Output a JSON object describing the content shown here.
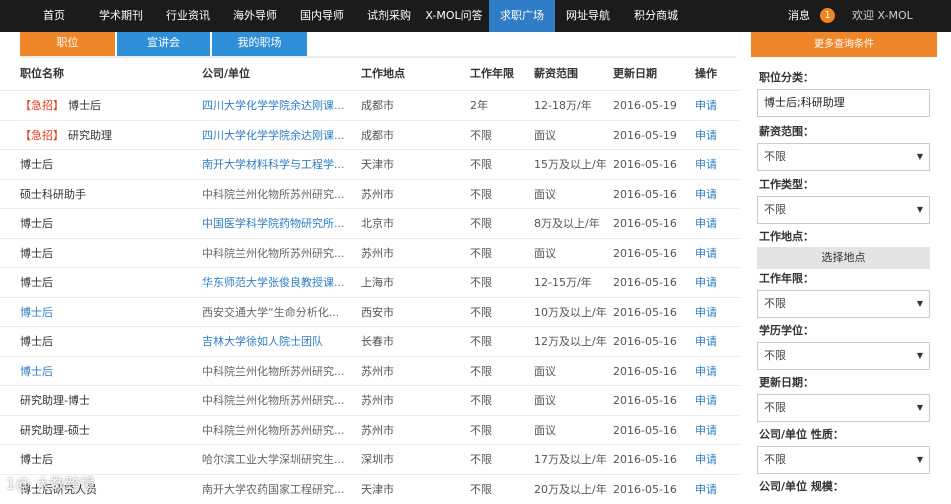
{
  "nav": {
    "items": [
      {
        "label": "首页",
        "active": false
      },
      {
        "label": "学术期刊",
        "active": false
      },
      {
        "label": "行业资讯",
        "active": false
      },
      {
        "label": "海外导师",
        "active": false
      },
      {
        "label": "国内导师",
        "active": false
      },
      {
        "label": "试剂采购",
        "active": false
      },
      {
        "label": "X-MOL问答",
        "active": false
      },
      {
        "label": "求职广场",
        "active": true
      },
      {
        "label": "网址导航",
        "active": false
      },
      {
        "label": "积分商城",
        "active": false
      }
    ],
    "messages_label": "消息",
    "messages_count": "1",
    "welcome": "欢迎 X-MOL"
  },
  "tabs": [
    "职位",
    "宣讲会",
    "我的职场"
  ],
  "table": {
    "headers": [
      "职位名称",
      "公司/单位",
      "工作地点",
      "工作年限",
      "薪资范围",
      "更新日期",
      "操作"
    ],
    "rows": [
      {
        "urgent": "【急招】",
        "title": "博士后",
        "company": "四川大学化学学院余达刚课...",
        "city": "成都市",
        "years": "2年",
        "salary": "12-18万/年",
        "date": "2016-05-19",
        "action": "申请",
        "title_link": false,
        "company_link": true
      },
      {
        "urgent": "【急招】",
        "title": "研究助理",
        "company": "四川大学化学学院余达刚课...",
        "city": "成都市",
        "years": "不限",
        "salary": "面议",
        "date": "2016-05-19",
        "action": "申请",
        "title_link": false,
        "company_link": true
      },
      {
        "urgent": "",
        "title": "博士后",
        "company": "南开大学材料科学与工程学...",
        "city": "天津市",
        "years": "不限",
        "salary": "15万及以上/年",
        "date": "2016-05-16",
        "action": "申请",
        "title_link": false,
        "company_link": true
      },
      {
        "urgent": "",
        "title": "硕士科研助手",
        "company": "中科院兰州化物所苏州研究...",
        "city": "苏州市",
        "years": "不限",
        "salary": "面议",
        "date": "2016-05-16",
        "action": "申请",
        "title_link": false,
        "company_link": false
      },
      {
        "urgent": "",
        "title": "博士后",
        "company": "中国医学科学院药物研究所...",
        "city": "北京市",
        "years": "不限",
        "salary": "8万及以上/年",
        "date": "2016-05-16",
        "action": "申请",
        "title_link": false,
        "company_link": true
      },
      {
        "urgent": "",
        "title": "博士后",
        "company": "中科院兰州化物所苏州研究...",
        "city": "苏州市",
        "years": "不限",
        "salary": "面议",
        "date": "2016-05-16",
        "action": "申请",
        "title_link": false,
        "company_link": false
      },
      {
        "urgent": "",
        "title": "博士后",
        "company": "华东师范大学张俊良教授课...",
        "city": "上海市",
        "years": "不限",
        "salary": "12-15万/年",
        "date": "2016-05-16",
        "action": "申请",
        "title_link": false,
        "company_link": true
      },
      {
        "urgent": "",
        "title": "博士后",
        "company": "西安交通大学“生命分析化...",
        "city": "西安市",
        "years": "不限",
        "salary": "10万及以上/年",
        "date": "2016-05-16",
        "action": "申请",
        "title_link": true,
        "company_link": false
      },
      {
        "urgent": "",
        "title": "博士后",
        "company": "吉林大学徐如人院士团队",
        "city": "长春市",
        "years": "不限",
        "salary": "12万及以上/年",
        "date": "2016-05-16",
        "action": "申请",
        "title_link": false,
        "company_link": true
      },
      {
        "urgent": "",
        "title": "博士后",
        "company": "中科院兰州化物所苏州研究...",
        "city": "苏州市",
        "years": "不限",
        "salary": "面议",
        "date": "2016-05-16",
        "action": "申请",
        "title_link": true,
        "company_link": false
      },
      {
        "urgent": "",
        "title": "研究助理-博士",
        "company": "中科院兰州化物所苏州研究...",
        "city": "苏州市",
        "years": "不限",
        "salary": "面议",
        "date": "2016-05-16",
        "action": "申请",
        "title_link": false,
        "company_link": false
      },
      {
        "urgent": "",
        "title": "研究助理-硕士",
        "company": "中科院兰州化物所苏州研究...",
        "city": "苏州市",
        "years": "不限",
        "salary": "面议",
        "date": "2016-05-16",
        "action": "申请",
        "title_link": false,
        "company_link": false
      },
      {
        "urgent": "",
        "title": "博士后",
        "company": "哈尔滨工业大学深圳研究生...",
        "city": "深圳市",
        "years": "不限",
        "salary": "17万及以上/年",
        "date": "2016-05-16",
        "action": "申请",
        "title_link": false,
        "company_link": false
      },
      {
        "urgent": "",
        "title": "博士后研究人员",
        "company": "南开大学农药国家工程研究...",
        "city": "天津市",
        "years": "不限",
        "salary": "20万及以上/年",
        "date": "2016-05-16",
        "action": "申请",
        "title_link": false,
        "company_link": false
      }
    ]
  },
  "sidebar": {
    "header": "更多查询条件",
    "category_label": "职位分类：",
    "category_value": "博士后;科研助理",
    "salary_label": "薪资范围：",
    "salary_value": "不限",
    "jobtype_label": "工作类型：",
    "jobtype_value": "不限",
    "location_label": "工作地点：",
    "location_button": "选择地点",
    "years_label": "工作年限：",
    "years_value": "不限",
    "degree_label": "学历学位：",
    "degree_value": "不限",
    "updated_label": "更新日期：",
    "updated_value": "不限",
    "org_nature_label": "公司/单位 性质：",
    "org_nature_value": "不限",
    "org_scale_label": "公司/单位 规模："
  },
  "watermark": "1@ 大数跨境"
}
